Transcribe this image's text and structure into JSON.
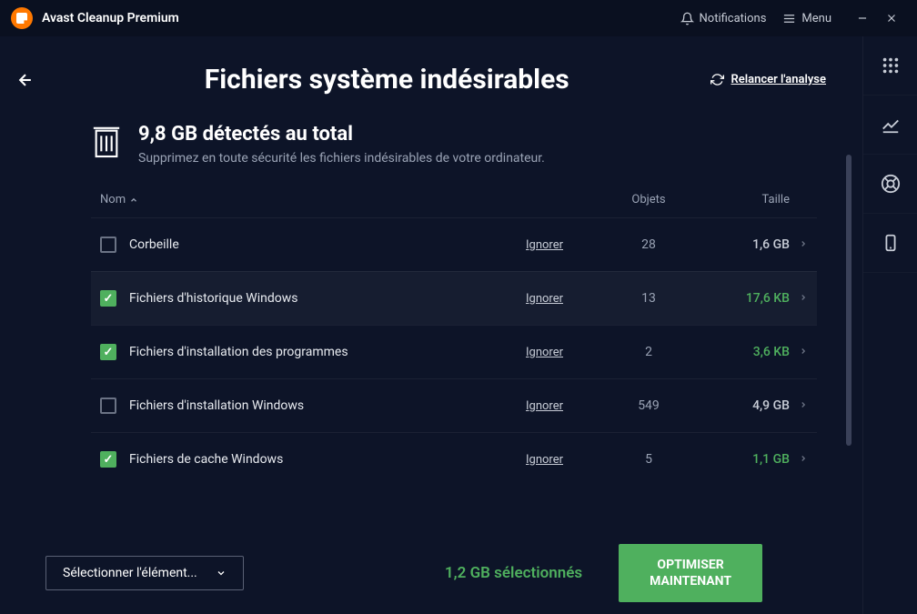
{
  "titlebar": {
    "app_name": "Avast Cleanup Premium",
    "notifications": "Notifications",
    "menu": "Menu"
  },
  "page": {
    "title": "Fichiers système indésirables",
    "rescan": "Relancer l'analyse"
  },
  "summary": {
    "headline": "9,8 GB détectés au total",
    "subtext": "Supprimez en toute sécurité les fichiers indésirables de votre ordinateur."
  },
  "table": {
    "col_name": "Nom",
    "col_objects": "Objets",
    "col_size": "Taille",
    "ignore_label": "Ignorer",
    "rows": [
      {
        "checked": false,
        "name": "Corbeille",
        "objects": "28",
        "size": "1,6 GB",
        "green": false,
        "highlighted": false
      },
      {
        "checked": true,
        "name": "Fichiers d'historique Windows",
        "objects": "13",
        "size": "17,6 KB",
        "green": true,
        "highlighted": true
      },
      {
        "checked": true,
        "name": "Fichiers d'installation des programmes",
        "objects": "2",
        "size": "3,6 KB",
        "green": true,
        "highlighted": false
      },
      {
        "checked": false,
        "name": "Fichiers d'installation Windows",
        "objects": "549",
        "size": "4,9 GB",
        "green": false,
        "highlighted": false
      },
      {
        "checked": true,
        "name": "Fichiers de cache Windows",
        "objects": "5",
        "size": "1,1 GB",
        "green": true,
        "highlighted": false
      }
    ]
  },
  "footer": {
    "select_label": "Sélectionner l'élément...",
    "selected_text": "1,2 GB sélectionnés",
    "optimize_line1": "OPTIMISER",
    "optimize_line2": "MAINTENANT"
  }
}
